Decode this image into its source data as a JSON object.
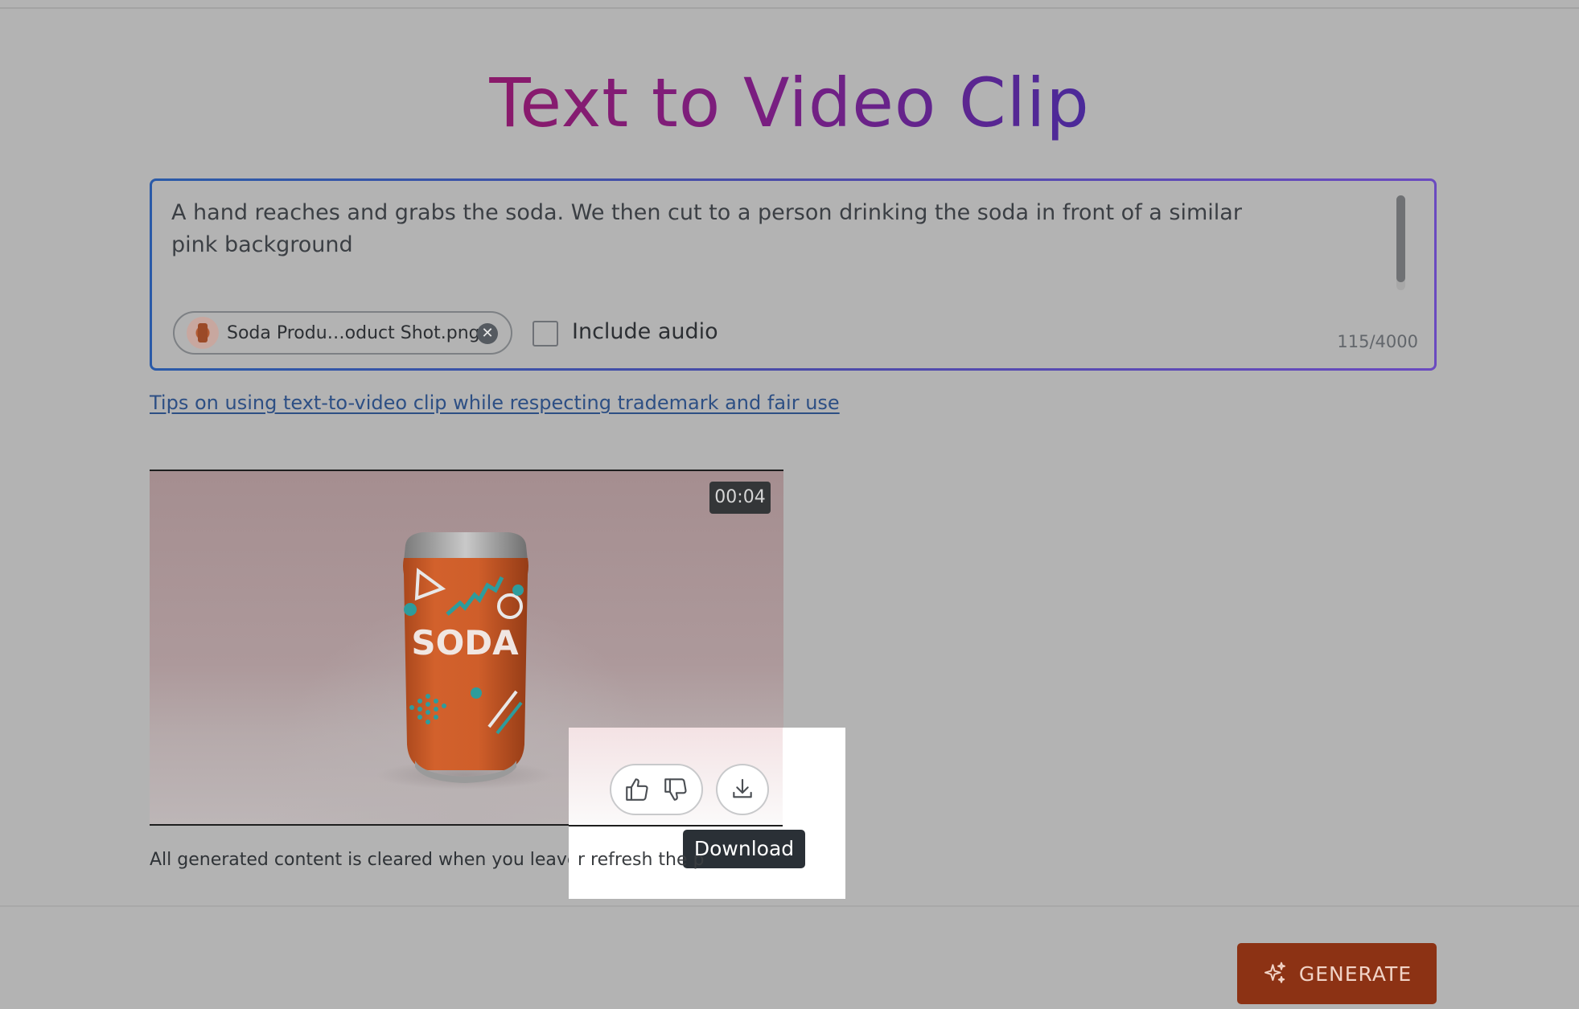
{
  "page": {
    "title": "Text to Video Clip"
  },
  "prompt": {
    "text": "A hand reaches and grabs the soda. We then cut to a person drinking the soda in front of a similar pink background",
    "char_count": "115/4000"
  },
  "attachment": {
    "file_name": "Soda Produ…oduct Shot.png",
    "remove_glyph": "✕"
  },
  "audio": {
    "label": "Include audio",
    "checked": false
  },
  "tips_link": "Tips on using text-to-video clip while respecting trademark and fair use",
  "video": {
    "duration": "00:04",
    "can_label": "SODA",
    "primary_color": "#d2612c",
    "accent_color": "#2e9c9c"
  },
  "actions": {
    "download_tooltip": "Download"
  },
  "notice": {
    "left": "All generated content is cleared when you leave o",
    "right": "r refresh the p"
  },
  "footer": {
    "generate_label": "GENERATE"
  }
}
